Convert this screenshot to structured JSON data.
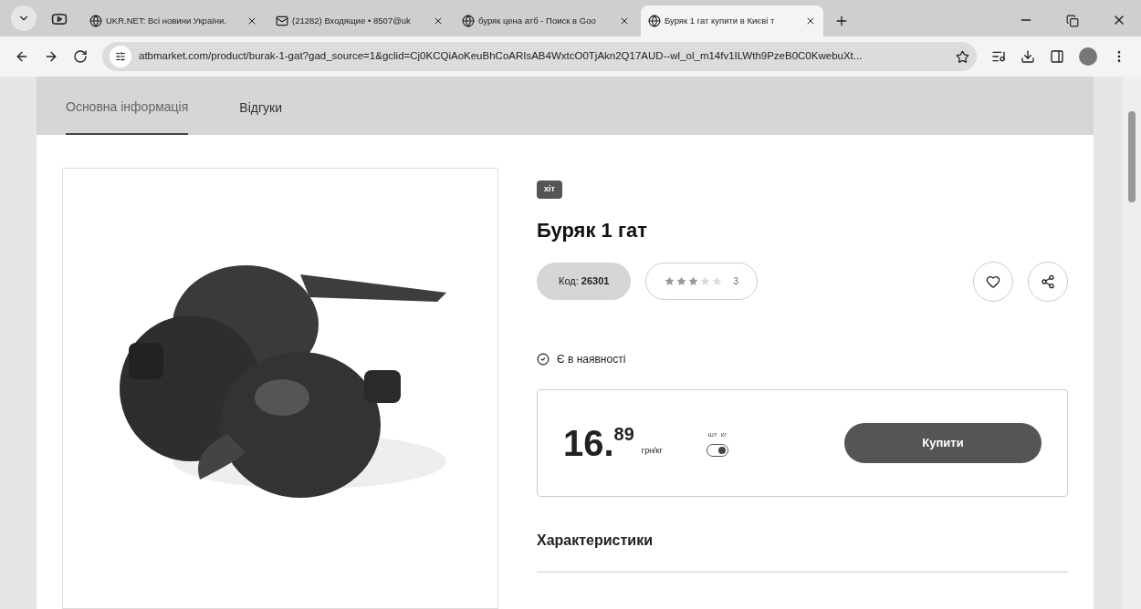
{
  "browser_tabs": [
    {
      "title": "UKR.NET: Всі новини України.",
      "selected": false
    },
    {
      "title": "(21282) Входящие • 8507@uk",
      "selected": false
    },
    {
      "title": "буряк цена атб - Поиск в Goo",
      "selected": false
    },
    {
      "title": "Буряк 1 гат купити в Києві т",
      "selected": true
    }
  ],
  "address_bar": {
    "url": "atbmarket.com/product/burak-1-gat?gad_source=1&gclid=Cj0KCQiAoKeuBhCoARIsAB4WxtcO0TjAkn2Q17AUD--wl_ol_m14fv1ILWth9PzeB0C0KwebuXt..."
  },
  "page_tabs": [
    {
      "label": "Основна інформація",
      "selected": true
    },
    {
      "label": "Відгуки",
      "selected": false
    }
  ],
  "product": {
    "badge": "хіт",
    "title": "Буряк 1 гат",
    "code_label": "Код:",
    "code": "26301",
    "stars": 3,
    "rating_count": "3",
    "availability": "Є в наявності",
    "price_whole": "16.",
    "price_fraction": "89",
    "price_unit": "грн/кг",
    "unit_toggle": {
      "left": "шт",
      "right": "кг",
      "on": true
    },
    "buy_button": "Купити",
    "section_title": "Характеристики"
  }
}
